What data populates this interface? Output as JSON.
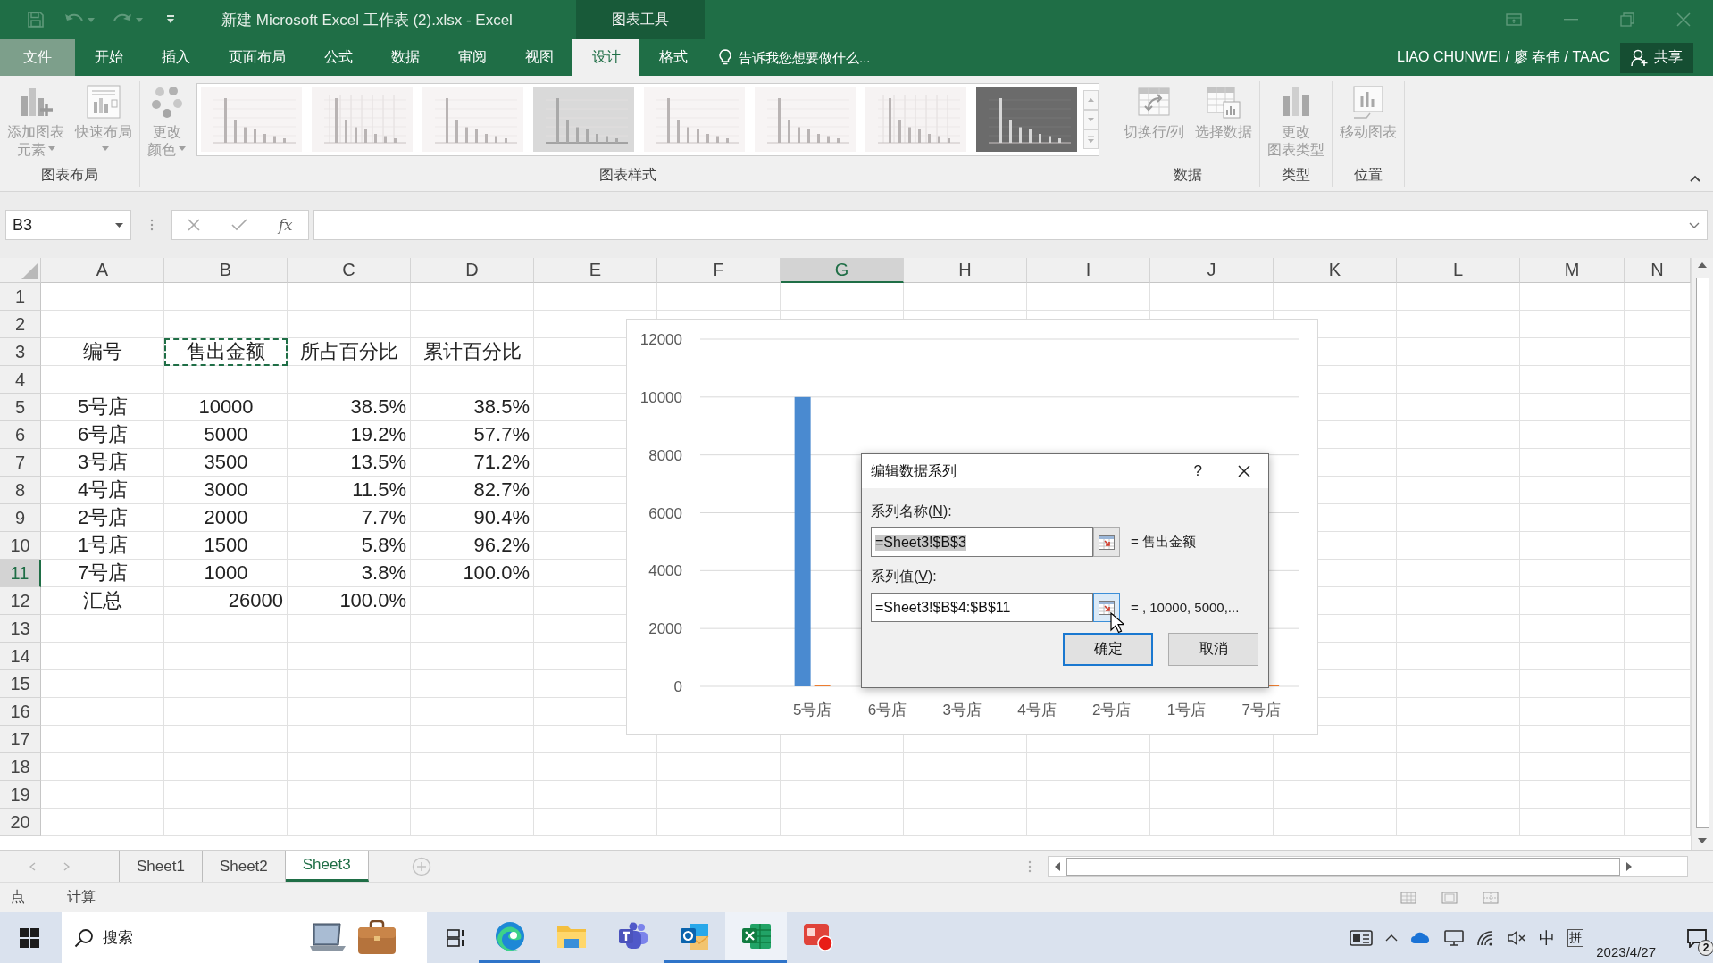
{
  "title_bar": {
    "title": "新建 Microsoft Excel 工作表 (2).xlsx - Excel",
    "context_tab": "图表工具"
  },
  "ribbon_tabs": [
    {
      "label": "文件",
      "kind": "file",
      "selected": false
    },
    {
      "label": "开始",
      "kind": "tab",
      "selected": false
    },
    {
      "label": "插入",
      "kind": "tab",
      "selected": false
    },
    {
      "label": "页面布局",
      "kind": "tab",
      "selected": false
    },
    {
      "label": "公式",
      "kind": "tab",
      "selected": false
    },
    {
      "label": "数据",
      "kind": "tab",
      "selected": false
    },
    {
      "label": "审阅",
      "kind": "tab",
      "selected": false
    },
    {
      "label": "视图",
      "kind": "tab",
      "selected": false
    },
    {
      "label": "设计",
      "kind": "tab",
      "selected": true
    },
    {
      "label": "格式",
      "kind": "tab",
      "selected": false
    }
  ],
  "tell_me": {
    "placeholder": "告诉我您想要做什么..."
  },
  "account": {
    "user": "LIAO CHUNWEI / 廖 春伟 / TAAC",
    "share": "共享"
  },
  "ribbon_groups": [
    {
      "label": "图表布局",
      "buttons": [
        {
          "lines": [
            "添加图表",
            "元素"
          ],
          "dropdown": true,
          "disabled": true
        },
        {
          "lines": [
            "快速布局"
          ],
          "dropdown": true,
          "disabled": true
        }
      ]
    },
    {
      "label": "图表样式",
      "buttons": [
        {
          "lines": [
            "更改",
            "颜色"
          ],
          "dropdown": true,
          "disabled": true
        }
      ],
      "gallery": [
        {
          "kind": "plain"
        },
        {
          "kind": "grid"
        },
        {
          "kind": "plain"
        },
        {
          "kind": "shaded"
        },
        {
          "kind": "plain"
        },
        {
          "kind": "plain"
        },
        {
          "kind": "grid"
        },
        {
          "kind": "dark"
        }
      ]
    },
    {
      "label": "数据",
      "buttons": [
        {
          "lines": [
            "切换行/列"
          ],
          "dropdown": false,
          "disabled": true
        },
        {
          "lines": [
            "选择数据"
          ],
          "dropdown": false,
          "disabled": true
        }
      ]
    },
    {
      "label": "类型",
      "buttons": [
        {
          "lines": [
            "更改",
            "图表类型"
          ],
          "dropdown": false,
          "disabled": true
        }
      ]
    },
    {
      "label": "位置",
      "buttons": [
        {
          "lines": [
            "移动图表"
          ],
          "dropdown": false,
          "disabled": true
        }
      ]
    }
  ],
  "formula_bar": {
    "name_box": "B3",
    "function_button": "fx"
  },
  "columns": [
    {
      "label": "A",
      "selected": false
    },
    {
      "label": "B",
      "selected": false
    },
    {
      "label": "C",
      "selected": false
    },
    {
      "label": "D",
      "selected": false
    },
    {
      "label": "E",
      "selected": false
    },
    {
      "label": "F",
      "selected": false
    },
    {
      "label": "G",
      "selected": true
    },
    {
      "label": "H",
      "selected": false
    },
    {
      "label": "I",
      "selected": false
    },
    {
      "label": "J",
      "selected": false
    },
    {
      "label": "K",
      "selected": false
    },
    {
      "label": "L",
      "selected": false
    },
    {
      "label": "M",
      "selected": false
    },
    {
      "label": "N",
      "selected": false
    }
  ],
  "rows": [
    {
      "label": "1",
      "selected": false
    },
    {
      "label": "2",
      "selected": false
    },
    {
      "label": "3",
      "selected": false,
      "cells": [
        {
          "text": "编号",
          "kind": "centered",
          "marquee": false
        },
        {
          "text": "售出金额",
          "kind": "centered",
          "marquee": true
        },
        {
          "text": "所占百分比",
          "kind": "centered",
          "marquee": false
        },
        {
          "text": "累计百分比",
          "kind": "centered",
          "marquee": false
        }
      ]
    },
    {
      "label": "4",
      "selected": false
    },
    {
      "label": "5",
      "selected": false,
      "cells": [
        {
          "text": "5号店",
          "kind": "centered",
          "marquee": false
        },
        {
          "text": "10000",
          "kind": "centered",
          "marquee": false
        },
        {
          "text": "38.5%",
          "kind": "right",
          "marquee": false
        },
        {
          "text": "38.5%",
          "kind": "right",
          "marquee": false
        }
      ]
    },
    {
      "label": "6",
      "selected": false,
      "cells": [
        {
          "text": "6号店",
          "kind": "centered",
          "marquee": false
        },
        {
          "text": "5000",
          "kind": "centered",
          "marquee": false
        },
        {
          "text": "19.2%",
          "kind": "right",
          "marquee": false
        },
        {
          "text": "57.7%",
          "kind": "right",
          "marquee": false
        }
      ]
    },
    {
      "label": "7",
      "selected": false,
      "cells": [
        {
          "text": "3号店",
          "kind": "centered",
          "marquee": false
        },
        {
          "text": "3500",
          "kind": "centered",
          "marquee": false
        },
        {
          "text": "13.5%",
          "kind": "right",
          "marquee": false
        },
        {
          "text": "71.2%",
          "kind": "right",
          "marquee": false
        }
      ]
    },
    {
      "label": "8",
      "selected": false,
      "cells": [
        {
          "text": "4号店",
          "kind": "centered",
          "marquee": false
        },
        {
          "text": "3000",
          "kind": "centered",
          "marquee": false
        },
        {
          "text": "11.5%",
          "kind": "right",
          "marquee": false
        },
        {
          "text": "82.7%",
          "kind": "right",
          "marquee": false
        }
      ]
    },
    {
      "label": "9",
      "selected": false,
      "cells": [
        {
          "text": "2号店",
          "kind": "centered",
          "marquee": false
        },
        {
          "text": "2000",
          "kind": "centered",
          "marquee": false
        },
        {
          "text": "7.7%",
          "kind": "right",
          "marquee": false
        },
        {
          "text": "90.4%",
          "kind": "right",
          "marquee": false
        }
      ]
    },
    {
      "label": "10",
      "selected": false,
      "cells": [
        {
          "text": "1号店",
          "kind": "centered",
          "marquee": false
        },
        {
          "text": "1500",
          "kind": "centered",
          "marquee": false
        },
        {
          "text": "5.8%",
          "kind": "right",
          "marquee": false
        },
        {
          "text": "96.2%",
          "kind": "right",
          "marquee": false
        }
      ]
    },
    {
      "label": "11",
      "selected": true,
      "cells": [
        {
          "text": "7号店",
          "kind": "centered",
          "marquee": false
        },
        {
          "text": "1000",
          "kind": "centered",
          "marquee": false
        },
        {
          "text": "3.8%",
          "kind": "right",
          "marquee": false
        },
        {
          "text": "100.0%",
          "kind": "right",
          "marquee": false
        }
      ]
    },
    {
      "label": "12",
      "selected": false,
      "cells": [
        {
          "text": "汇总",
          "kind": "centered",
          "marquee": false
        },
        {
          "text": "26000",
          "kind": "right",
          "marquee": false
        },
        {
          "text": "100.0%",
          "kind": "right",
          "marquee": false
        }
      ]
    },
    {
      "label": "13",
      "selected": false
    },
    {
      "label": "14",
      "selected": false
    },
    {
      "label": "15",
      "selected": false
    },
    {
      "label": "16",
      "selected": false
    },
    {
      "label": "17",
      "selected": false
    },
    {
      "label": "18",
      "selected": false
    },
    {
      "label": "19",
      "selected": false
    },
    {
      "label": "20",
      "selected": false
    }
  ],
  "chart": {
    "chart_data": {
      "type": "bar",
      "categories": [
        null,
        "5号店",
        "6号店",
        "3号店",
        "4号店",
        "2号店",
        "1号店",
        "7号店"
      ],
      "series": [
        {
          "color": "#4a8ad0",
          "values": [
            null,
            10000,
            null,
            null,
            null,
            null,
            null,
            null
          ]
        },
        {
          "color": "#ed7d31",
          "values": [
            null,
            0,
            null,
            null,
            null,
            null,
            null,
            0
          ]
        }
      ],
      "ylim": [
        0,
        12000
      ],
      "yticks": [
        0,
        2000,
        4000,
        6000,
        8000,
        10000,
        12000
      ],
      "grid": true
    }
  },
  "dialog": {
    "title": "编辑数据系列",
    "help": "?",
    "fields": [
      {
        "label_before": "系列名称(",
        "access_key": "N",
        "label_after": "):",
        "value": "=Sheet3!$B$3",
        "value_selected": true,
        "picker_hovered": false,
        "preview": "= 售出金额"
      },
      {
        "label_before": "系列值(",
        "access_key": "V",
        "label_after": "):",
        "value": "=Sheet3!$B$4:$B$11",
        "value_selected": false,
        "picker_hovered": true,
        "preview": "= , 10000, 5000,..."
      }
    ],
    "buttons": [
      {
        "label": "确定",
        "default": true
      },
      {
        "label": "取消",
        "default": false
      }
    ]
  },
  "sheet_tabs": [
    {
      "label": "Sheet1",
      "selected": false
    },
    {
      "label": "Sheet2",
      "selected": false
    },
    {
      "label": "Sheet3",
      "selected": true
    }
  ],
  "status_bar": {
    "items": [
      "点",
      "计算"
    ]
  },
  "taskbar": {
    "search": {
      "placeholder": "搜索"
    },
    "apps": [
      {
        "running": true,
        "active": false
      },
      {
        "running": false,
        "active": false
      },
      {
        "running": false,
        "active": false
      },
      {
        "running": true,
        "active": false
      },
      {
        "running": true,
        "active": true
      },
      {
        "running": false,
        "active": false
      }
    ],
    "tray": {
      "ime": "中",
      "ime_mode": "拼",
      "date": "2023/4/27",
      "notifications": "2"
    }
  }
}
